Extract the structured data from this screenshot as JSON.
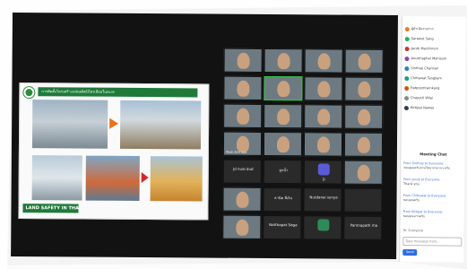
{
  "slide": {
    "header": "การติดตั้งโครงสร้างแท่นผลิตปิโตรเลียมในทะเล",
    "footer": "LAND SAFETY IN THAI"
  },
  "gallery": {
    "tiles": [
      {
        "label": "",
        "kind": "video"
      },
      {
        "label": "",
        "kind": "video"
      },
      {
        "label": "",
        "kind": "video"
      },
      {
        "label": "",
        "kind": "video"
      },
      {
        "label": "",
        "kind": "video"
      },
      {
        "label": "",
        "kind": "video"
      },
      {
        "label": "",
        "kind": "video"
      },
      {
        "label": "",
        "kind": "video"
      },
      {
        "label": "",
        "kind": "video"
      },
      {
        "label": "",
        "kind": "video"
      },
      {
        "label": "",
        "kind": "video"
      },
      {
        "label": "",
        "kind": "video"
      },
      {
        "label": "Wadi Athi aga",
        "kind": "video"
      },
      {
        "label": "",
        "kind": "video"
      },
      {
        "label": "",
        "kind": "video"
      },
      {
        "label": "",
        "kind": "video"
      },
      {
        "label": "",
        "kind": "dark",
        "name": "Jd nuai dud"
      },
      {
        "label": "",
        "kind": "dark",
        "name": "ลูกน้ำ"
      },
      {
        "label": "",
        "kind": "dark",
        "name": "D",
        "avatar": "#5b5bd6"
      },
      {
        "label": "",
        "kind": "video"
      },
      {
        "label": "",
        "kind": "video"
      },
      {
        "label": "",
        "kind": "dark",
        "name": "ธานิต สีเงิน"
      },
      {
        "label": "",
        "kind": "dark",
        "name": "Nutdanai sonya"
      },
      {
        "label": "",
        "kind": "dark",
        "name": ""
      },
      {
        "label": "",
        "kind": "video"
      },
      {
        "label": "",
        "kind": "dark",
        "name": "Natthapat Saga"
      },
      {
        "label": "",
        "kind": "dark",
        "name": "",
        "avatar": "#2e8b57"
      },
      {
        "label": "",
        "kind": "dark",
        "name": "Pantnapath ma"
      }
    ]
  },
  "participants": [
    {
      "name": "ผู้ดำเนินรายการ",
      "color": "#e67e22"
    },
    {
      "name": "Sarawut Sang",
      "color": "#27ae60"
    },
    {
      "name": "Jacob Mackinnon",
      "color": "#c0392b"
    },
    {
      "name": "Anutthaphat Mahisorn",
      "color": "#8e44ad"
    },
    {
      "name": "Sinthop Chanhan",
      "color": "#2980b9"
    },
    {
      "name": "Chittawat Tangkam",
      "color": "#16a085"
    },
    {
      "name": "Ratpoomtarnkang",
      "color": "#d35400"
    },
    {
      "name": "Chayutti Wilai",
      "color": "#7f8c8d"
    },
    {
      "name": "Kittipat Nawee",
      "color": "#2c3e50"
    }
  ],
  "chat": {
    "title": "Meeting Chat",
    "messages": [
      {
        "who": "From Sinthop to Everyone:",
        "text": "ขอบคุณครับท่านวิทยากรมากๆ ครับ"
      },
      {
        "who": "From Jacob to Everyone:",
        "text": "Thank you"
      },
      {
        "who": "From Chittawat to Everyone:",
        "text": "ขอบคุณครับ"
      },
      {
        "who": "From Kittipat to Everyone:",
        "text": "ขอบคุณมากครับ"
      }
    ],
    "to_label": "To: Everyone",
    "input_placeholder": "Type message here...",
    "send_label": "Send"
  }
}
